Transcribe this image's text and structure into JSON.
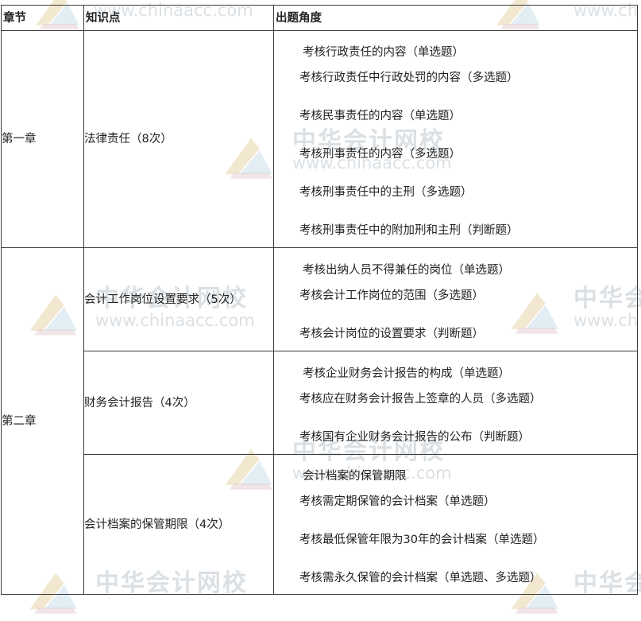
{
  "table": {
    "headers": {
      "chapter": "章节",
      "point": "知识点",
      "angle": "出题角度"
    },
    "rows": [
      {
        "chapter": "第一章",
        "point": "法律责任（8次）",
        "angles": [
          "考核行政责任的内容（单选题）",
          "考核行政责任中行政处罚的内容（多选题）",
          "考核民事责任的内容（单选题）",
          "考核刑事责任的内容（多选题）",
          "考核刑事责任中的主刑（多选题）",
          "考核刑事责任中的附加刑和主刑（判断题）"
        ]
      },
      {
        "chapter": "第二章",
        "point": "会计工作岗位设置要求（5次）",
        "angles": [
          "考核出纳人员不得兼任的岗位（单选题）",
          "考核会计工作岗位的范围（多选题）",
          "考核会计岗位的设置要求（判断题）"
        ]
      },
      {
        "chapter": "",
        "point": "财务会计报告（4次）",
        "angles": [
          "考核企业财务会计报告的构成（单选题）",
          "考核应在财务会计报告上签章的人员（多选题）",
          "考核国有企业财务会计报告的公布（判断题）"
        ]
      },
      {
        "chapter": "",
        "point": "会计档案的保管期限（4次）",
        "angles": [
          "会计档案的保管期限",
          "考核需定期保管的会计档案（单选题）",
          "考核最低保管年限为30年的会计档案（单选题）",
          "考核需永久保管的会计档案（单选题、多选题）"
        ]
      }
    ]
  },
  "watermark": {
    "name_cn": "中华会计网校",
    "url": "www.chinaacc.com",
    "url_partial": "www.ch",
    "name_partial": "中华会"
  },
  "colors": {
    "border": "#3a3a3a",
    "text": "#222222",
    "watermark": "#cfd6dc"
  }
}
